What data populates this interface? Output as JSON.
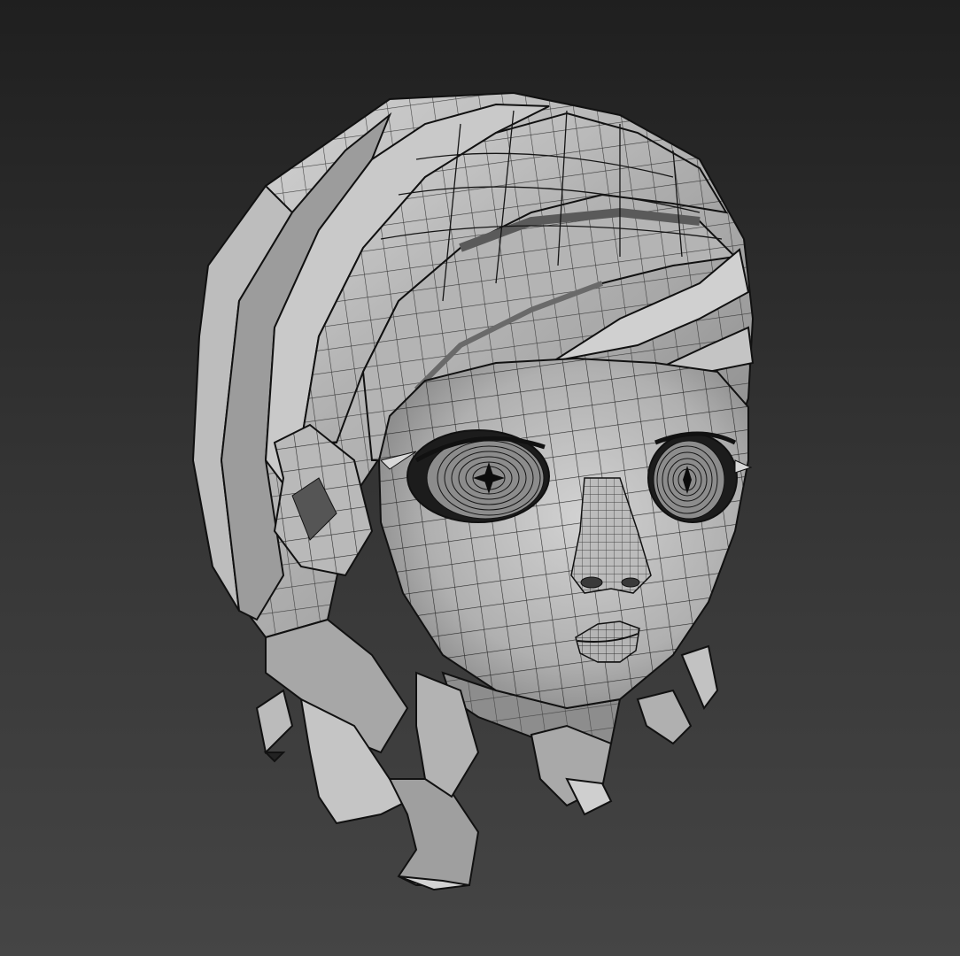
{
  "viewport": {
    "background_top": "#1f1f1f",
    "background_bottom": "#454545",
    "mesh_fill": "#a9a9a9",
    "mesh_light": "#c8c8c8",
    "mesh_shadow": "#6e6e6e",
    "wire_color": "#111111"
  },
  "model": {
    "subject": "wireframe-head-icon"
  }
}
